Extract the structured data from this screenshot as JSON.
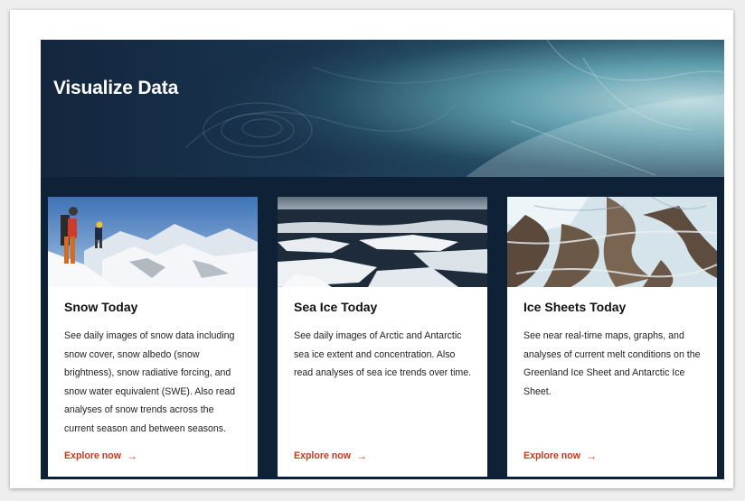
{
  "hero": {
    "title": "Visualize Data"
  },
  "cards": [
    {
      "title": "Snow Today",
      "description": "See daily images of snow data including snow cover, snow albedo (snow brightness), snow radiative forcing, and snow water equivalent (SWE). Also read analyses of snow trends across the current season and between seasons.",
      "link_label": "Explore now",
      "link_icon": "arrow-right-icon"
    },
    {
      "title": "Sea Ice Today",
      "description": "See daily images of Arctic and Antarctic sea ice extent and concentration. Also read analyses of sea ice trends over time.",
      "link_label": "Explore now",
      "link_icon": "arrow-right-icon"
    },
    {
      "title": "Ice Sheets Today",
      "description": "See near real-time maps, graphs, and analyses of current melt conditions on the Greenland Ice Sheet and Antarctic Ice Sheet.",
      "link_label": "Explore now",
      "link_icon": "arrow-right-icon"
    }
  ],
  "colors": {
    "panel_background": "#0e2136",
    "link_accent": "#c2391b",
    "card_background": "#ffffff"
  }
}
